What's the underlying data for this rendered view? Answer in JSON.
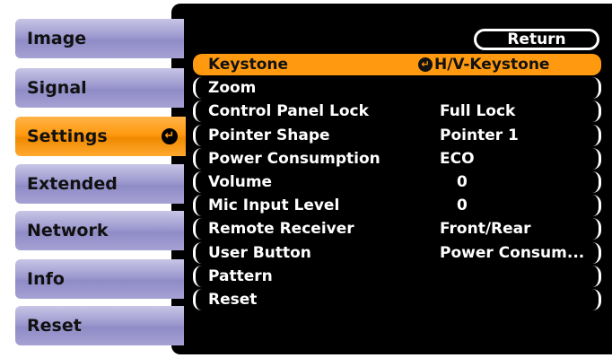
{
  "tabs": [
    {
      "label": "Image"
    },
    {
      "label": "Signal"
    },
    {
      "label": "Settings",
      "active": true
    },
    {
      "label": "Extended"
    },
    {
      "label": "Network"
    },
    {
      "label": "Info"
    },
    {
      "label": "Reset"
    }
  ],
  "return_label": "Return",
  "enter_glyph": "↵",
  "menu": [
    {
      "label": "Keystone",
      "value": "H/V-Keystone"
    },
    {
      "label": "Zoom",
      "value": ""
    },
    {
      "label": "Control Panel Lock",
      "value": "Full Lock"
    },
    {
      "label": "Pointer Shape",
      "value": "Pointer 1"
    },
    {
      "label": "Power Consumption",
      "value": "ECO"
    },
    {
      "label": "Volume",
      "value": "0"
    },
    {
      "label": "Mic Input Level",
      "value": "0"
    },
    {
      "label": "Remote Receiver",
      "value": "Front/Rear"
    },
    {
      "label": "User Button",
      "value": "Power Consum..."
    },
    {
      "label": "Pattern",
      "value": ""
    },
    {
      "label": "Reset",
      "value": ""
    }
  ],
  "colors": {
    "highlight": "#ff9a10",
    "tab": "#9d99cf",
    "panel": "#000000"
  }
}
